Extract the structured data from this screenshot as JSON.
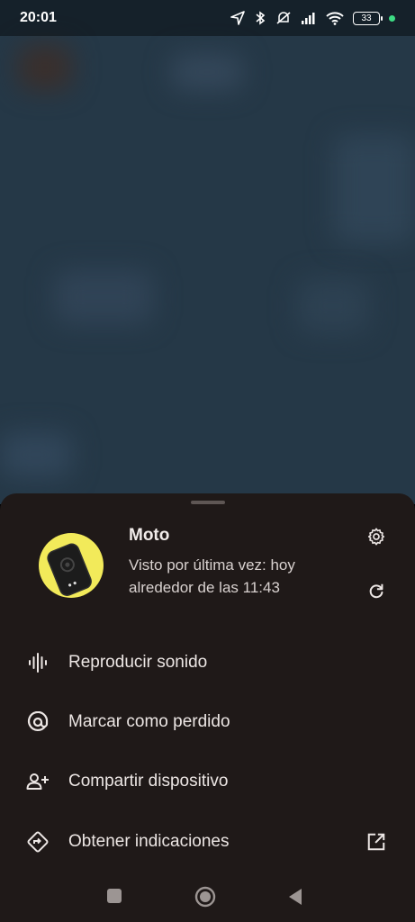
{
  "status_bar": {
    "time": "20:01",
    "battery_level": "33",
    "icons": [
      "location-icon",
      "bluetooth-icon",
      "silent-icon",
      "signal-icon",
      "wifi-icon",
      "battery-icon"
    ]
  },
  "device": {
    "name": "Moto",
    "last_seen": "Visto por última vez: hoy alrededor de las 11:43",
    "avatar_color": "#f2ea5a"
  },
  "actions": [
    {
      "label": "Reproducir sonido",
      "icon": "sound-wave-icon"
    },
    {
      "label": "Marcar como perdido",
      "icon": "lost-marker-icon"
    },
    {
      "label": "Compartir dispositivo",
      "icon": "person-add-icon"
    },
    {
      "label": "Obtener indicaciones",
      "icon": "directions-icon",
      "trailing_icon": "open-external-icon"
    }
  ],
  "colors": {
    "sheet_background": "#1f1918",
    "map_background": "#253847",
    "status_dot": "#3ddc84"
  }
}
